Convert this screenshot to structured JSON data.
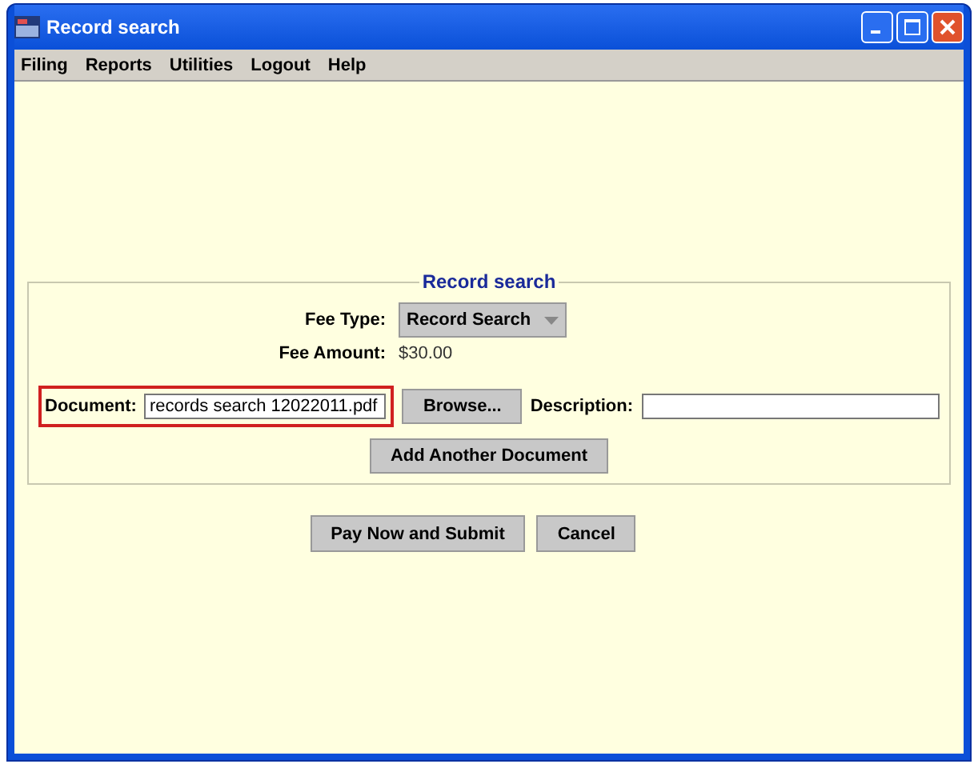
{
  "window": {
    "title": "Record search"
  },
  "menu": [
    "Filing",
    "Reports",
    "Utilities",
    "Logout",
    "Help"
  ],
  "form": {
    "legend": "Record search",
    "fee_type_label": "Fee Type:",
    "fee_type": "Record Search",
    "fee_amount_label": "Fee Amount:",
    "fee_amount": "$30.00",
    "document_label": "Document:",
    "document_value": "records search 12022011.pdf",
    "browse": "Browse...",
    "description_label": "Description:",
    "add_document": "Add Another Document"
  },
  "buttons": [
    "Pay Now and Submit",
    "Cancel"
  ]
}
